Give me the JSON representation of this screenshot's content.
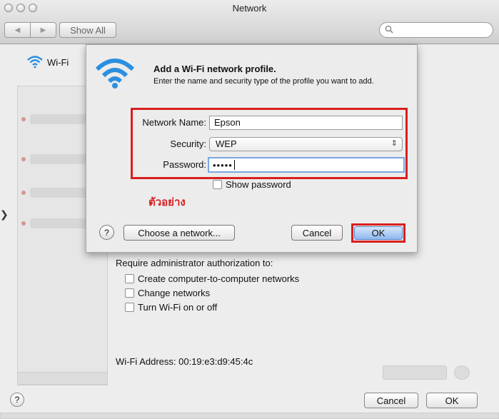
{
  "window": {
    "title": "Network"
  },
  "toolbar": {
    "show_all": "Show All",
    "search_placeholder": ""
  },
  "sidebar": {
    "wifi_label": "Wi-Fi"
  },
  "dialog": {
    "title": "Add a Wi-Fi network profile.",
    "description": "Enter the name and security type of the profile you want to add.",
    "network_name_label": "Network Name:",
    "network_name_value": "Epson",
    "security_label": "Security:",
    "security_value": "WEP",
    "password_label": "Password:",
    "password_masked": "•••••",
    "show_password_label": "Show password",
    "example_label": "ตัวอย่าง",
    "help_glyph": "?",
    "choose_network_label": "Choose a network...",
    "cancel_label": "Cancel",
    "ok_label": "OK"
  },
  "pane": {
    "admin_label": "Require administrator authorization to:",
    "options": [
      "Create computer-to-computer networks",
      "Change networks",
      "Turn Wi-Fi on or off"
    ],
    "wifi_address": "Wi-Fi Address: 00:19:e3:d9:45:4c"
  },
  "footer": {
    "help_glyph": "?",
    "cancel_label": "Cancel",
    "ok_label": "OK"
  },
  "colors": {
    "highlight_red": "#d91f1f",
    "ok_blue": "#8fb8ee",
    "wifi_blue": "#2b8fe0"
  }
}
